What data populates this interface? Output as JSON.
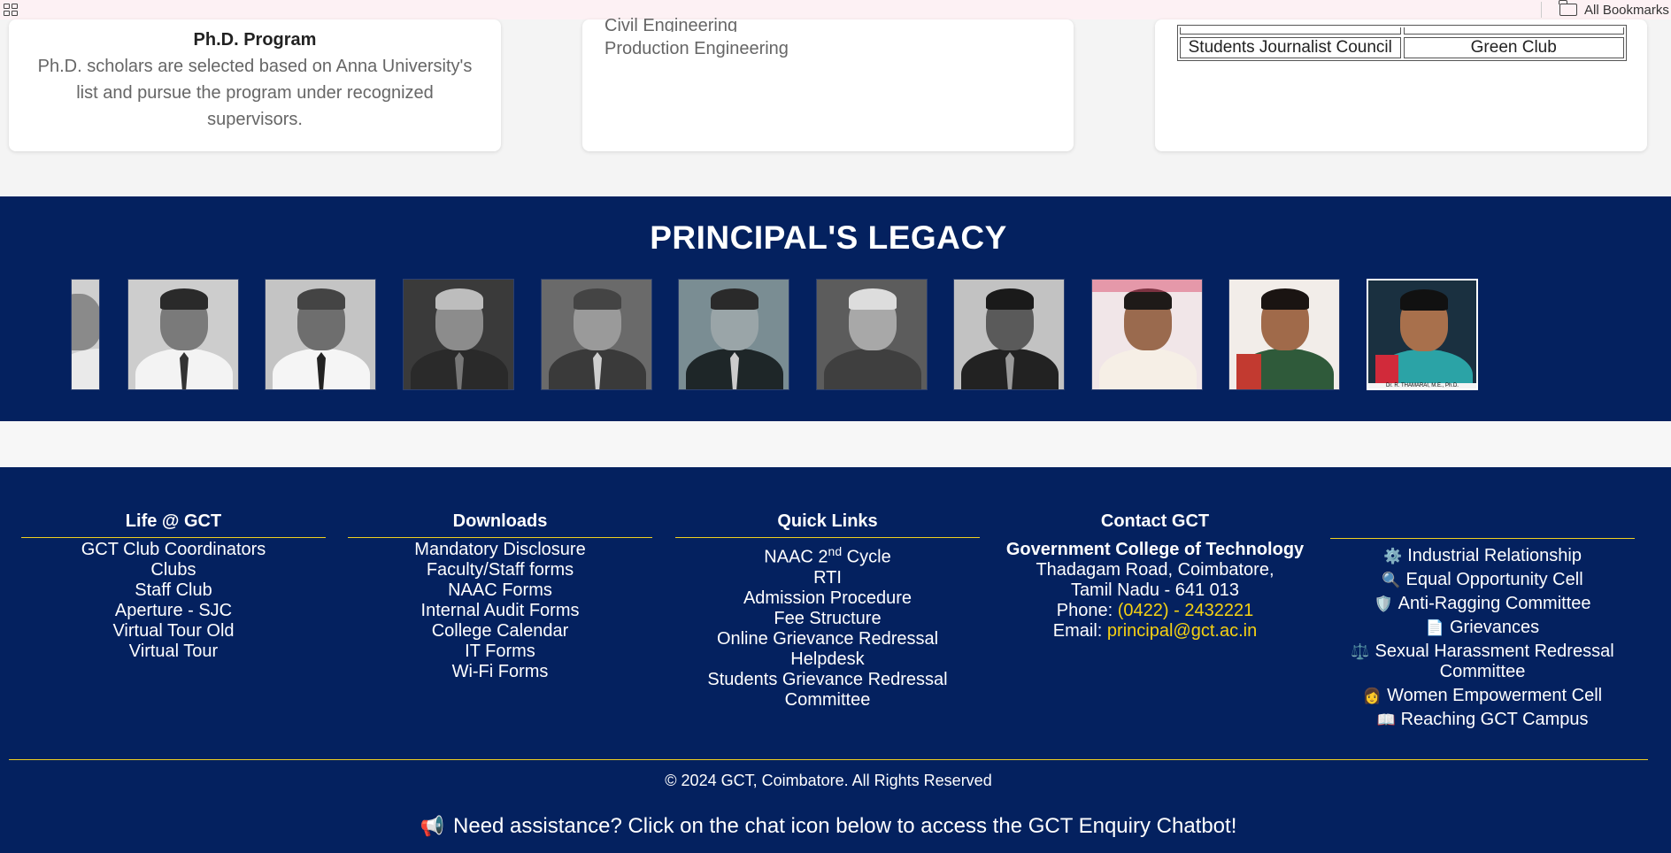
{
  "browser": {
    "all_bookmarks": "All Bookmarks"
  },
  "cards": {
    "phd_title": "Ph.D. Program",
    "phd_desc": "Ph.D. scholars are selected based on Anna University's list and pursue the program under recognized supervisors.",
    "eng_partial": "Civil Engineering",
    "eng_last": "Production Engineering",
    "clubs_row": [
      "Students Journalist Council",
      "Green Club"
    ]
  },
  "legacy": {
    "title": "PRINCIPAL'S LEGACY",
    "last_caption": "Dr. R. THAMARAI, M.E., Ph.D."
  },
  "footer": {
    "life": {
      "heading": "Life @ GCT",
      "items": [
        "GCT Club Coordinators",
        "Clubs",
        "Staff Club",
        "Aperture - SJC",
        "Virtual Tour Old",
        "Virtual Tour"
      ]
    },
    "downloads": {
      "heading": "Downloads",
      "items": [
        "Mandatory Disclosure",
        "Faculty/Staff forms",
        "NAAC Forms",
        "Internal Audit Forms",
        "College Calendar",
        "IT Forms",
        "Wi-Fi Forms"
      ]
    },
    "quick_links": {
      "heading": "Quick Links",
      "naac_pre": "NAAC 2",
      "naac_sup": "nd",
      "naac_post": " Cycle",
      "items": [
        "RTI",
        "Admission Procedure",
        "Fee Structure",
        "Online Grievance Redressal Helpdesk",
        "Students Grievance Redressal Committee"
      ]
    },
    "contact": {
      "heading": "Contact GCT",
      "name": "Government College of Technology",
      "address1": "Thadagam Road, Coimbatore,",
      "address2": "Tamil Nadu - 641 013",
      "phone_label": "Phone: ",
      "phone": "(0422) - 2432221",
      "email_label": "Email: ",
      "email": "principal@gct.ac.in"
    },
    "cells": {
      "items": [
        {
          "icon": "⚙️",
          "label": "Industrial Relationship"
        },
        {
          "icon": "🔍",
          "label": "Equal Opportunity Cell"
        },
        {
          "icon": "🛡️",
          "label": "Anti-Ragging Committee"
        },
        {
          "icon": "📄",
          "label": "Grievances"
        },
        {
          "icon": "⚖️",
          "label": "Sexual Harassment Redressal Committee"
        },
        {
          "icon": "👩",
          "label": "Women Empowerment Cell"
        },
        {
          "icon": "📖",
          "label": "Reaching GCT Campus"
        }
      ]
    },
    "copyright": "© 2024 GCT, Coimbatore. All Rights Reserved",
    "assist_icon": "📢",
    "assist": "Need assistance? Click on the chat icon below to access the GCT Enquiry Chatbot!"
  },
  "colors": {
    "navy": "#04215f",
    "accent_yellow": "#f5d113",
    "rule_yellow": "#f0d020"
  }
}
